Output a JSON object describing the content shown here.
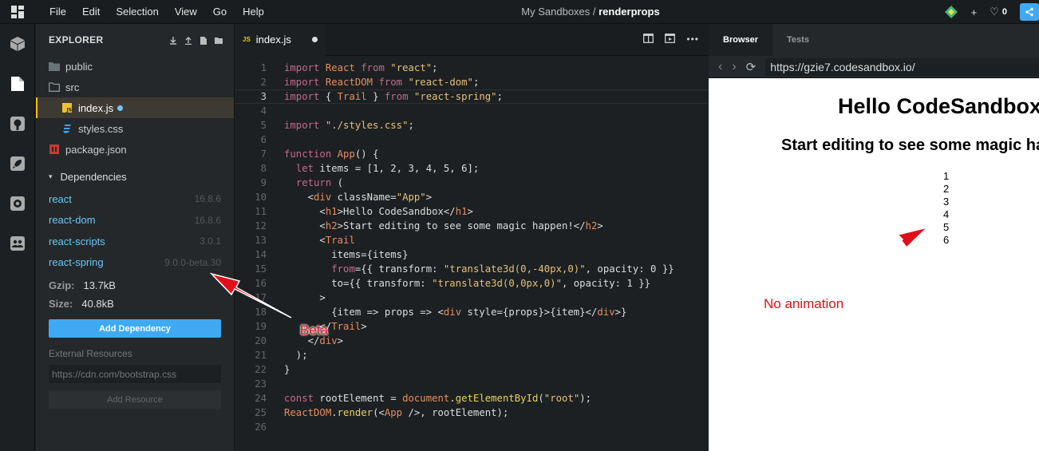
{
  "menu": {
    "items": [
      "File",
      "Edit",
      "Selection",
      "View",
      "Go",
      "Help"
    ],
    "title_prefix": "My Sandboxes / ",
    "title_name": "renderprops",
    "like_count": "0",
    "plus_label": "+"
  },
  "explorer": {
    "heading": "EXPLORER",
    "files": [
      {
        "name": "public",
        "type": "folder"
      },
      {
        "name": "src",
        "type": "folder-open"
      },
      {
        "name": "index.js",
        "type": "js",
        "active": true
      },
      {
        "name": "styles.css",
        "type": "css"
      },
      {
        "name": "package.json",
        "type": "json"
      }
    ],
    "dependencies_heading": "Dependencies",
    "dependencies": [
      {
        "name": "react",
        "version": "16.8.6"
      },
      {
        "name": "react-dom",
        "version": "16.8.6"
      },
      {
        "name": "react-scripts",
        "version": "3.0.1"
      },
      {
        "name": "react-spring",
        "version": "9.0.0-beta.30"
      }
    ],
    "gzip_label": "Gzip:",
    "gzip_value": "13.7kB",
    "size_label": "Size:",
    "size_value": "40.8kB",
    "add_dependency": "Add Dependency",
    "external_resources": "External Resources",
    "resource_placeholder": "https://cdn.com/bootstrap.css",
    "add_resource": "Add Resource"
  },
  "editor": {
    "tab_icon": "JS",
    "tab_name": "index.js",
    "current_line": 3,
    "lines": [
      "import React from \"react\";",
      "import ReactDOM from \"react-dom\";",
      "import { Trail } from \"react-spring\";",
      "",
      "import \"./styles.css\";",
      "",
      "function App() {",
      "  let items = [1, 2, 3, 4, 5, 6];",
      "  return (",
      "    <div className=\"App\">",
      "      <h1>Hello CodeSandbox</h1>",
      "      <h2>Start editing to see some magic happen!</h2>",
      "      <Trail",
      "        items={items}",
      "        from={{ transform: \"translate3d(0,-40px,0)\", opacity: 0 }}",
      "        to={{ transform: \"translate3d(0,0px,0)\", opacity: 1 }}",
      "      >",
      "        {item => props => <div style={props}>{item}</div>}",
      "      </Trail>",
      "    </div>",
      "  );",
      "}",
      "",
      "const rootElement = document.getElementById(\"root\");",
      "ReactDOM.render(<App />, rootElement);",
      ""
    ]
  },
  "preview": {
    "tabs": [
      "Browser",
      "Tests"
    ],
    "url": "https://gzie7.codesandbox.io/",
    "h1": "Hello CodeSandbox",
    "h2": "Start editing to see some magic happen!",
    "items": [
      "1",
      "2",
      "3",
      "4",
      "5",
      "6"
    ]
  },
  "annotations": {
    "beta": "Beta",
    "no_animation": "No animation",
    "color": "#e0101a"
  }
}
